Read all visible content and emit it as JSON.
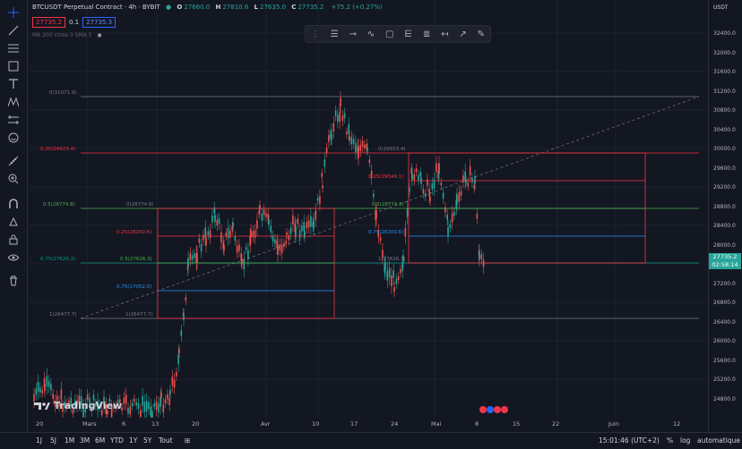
{
  "header": {
    "symbol": "BTCUSDT Perpetual Contract · 4h · BYBIT",
    "ohlc": {
      "o_label": "O",
      "o": "27660.0",
      "h_label": "H",
      "h": "27810.6",
      "l_label": "L",
      "l": "27635.0",
      "c_label": "C",
      "c": "27735.2",
      "change": "+75.2 (+0.27%)"
    },
    "bid": "27735.2",
    "spread": "0.1",
    "ask": "27735.3",
    "ma_legend": "MA 200 close 0 SMA 5"
  },
  "price_scale": {
    "currency": "USDT",
    "ticks": [
      "32400.0",
      "32000.0",
      "31600.0",
      "31200.0",
      "30800.0",
      "30400.0",
      "30000.0",
      "29600.0",
      "29200.0",
      "28800.0",
      "28400.0",
      "28000.0",
      "27600.0",
      "27200.0",
      "26800.0",
      "26400.0",
      "26000.0",
      "25600.0",
      "25200.0",
      "24800.0"
    ],
    "current_price": "27735.2",
    "countdown": "02:58:14"
  },
  "time_axis": {
    "ticks": [
      "20",
      "Mars",
      "6",
      "13",
      "20",
      "Avr",
      "10",
      "17",
      "24",
      "Mai",
      "8",
      "15",
      "22",
      "Juin",
      "12"
    ]
  },
  "fib_left": {
    "l0": "0(28774.8)",
    "l025": "0.25(28200.6)",
    "l05": "0.5(27626.3)",
    "l075": "0.75(27052.0)",
    "l1": "1(26477.7)"
  },
  "fib_big": {
    "l0": "0(31071.9)",
    "l025": "0.25(29923.4)",
    "l05": "0.5(28774.8)",
    "l075": "0.75(27626.3)",
    "l1": "1(26477.7)"
  },
  "fib_right": {
    "l0": "0(29923.4)",
    "l025": "0.25(29349.1)",
    "l05": "0.5(28774.8)",
    "l075": "0.75(28200.6)",
    "l1": "1(27626.3)"
  },
  "branding": {
    "logo": "TradingView"
  },
  "bottom_bar": {
    "periods": [
      "1J",
      "5J",
      "1M",
      "3M",
      "6M",
      "YTD",
      "1Y",
      "5Y",
      "Tout"
    ],
    "clock": "15:01:46 (UTC+2)",
    "percent": "%",
    "log": "log",
    "auto": "automatique"
  },
  "colors": {
    "background": "#131722",
    "up": "#26a69a",
    "down": "#ef5350",
    "fib_red": "#f23645",
    "fib_green": "#4caf50",
    "fib_teal": "#089981",
    "fib_blue": "#2196f3"
  }
}
